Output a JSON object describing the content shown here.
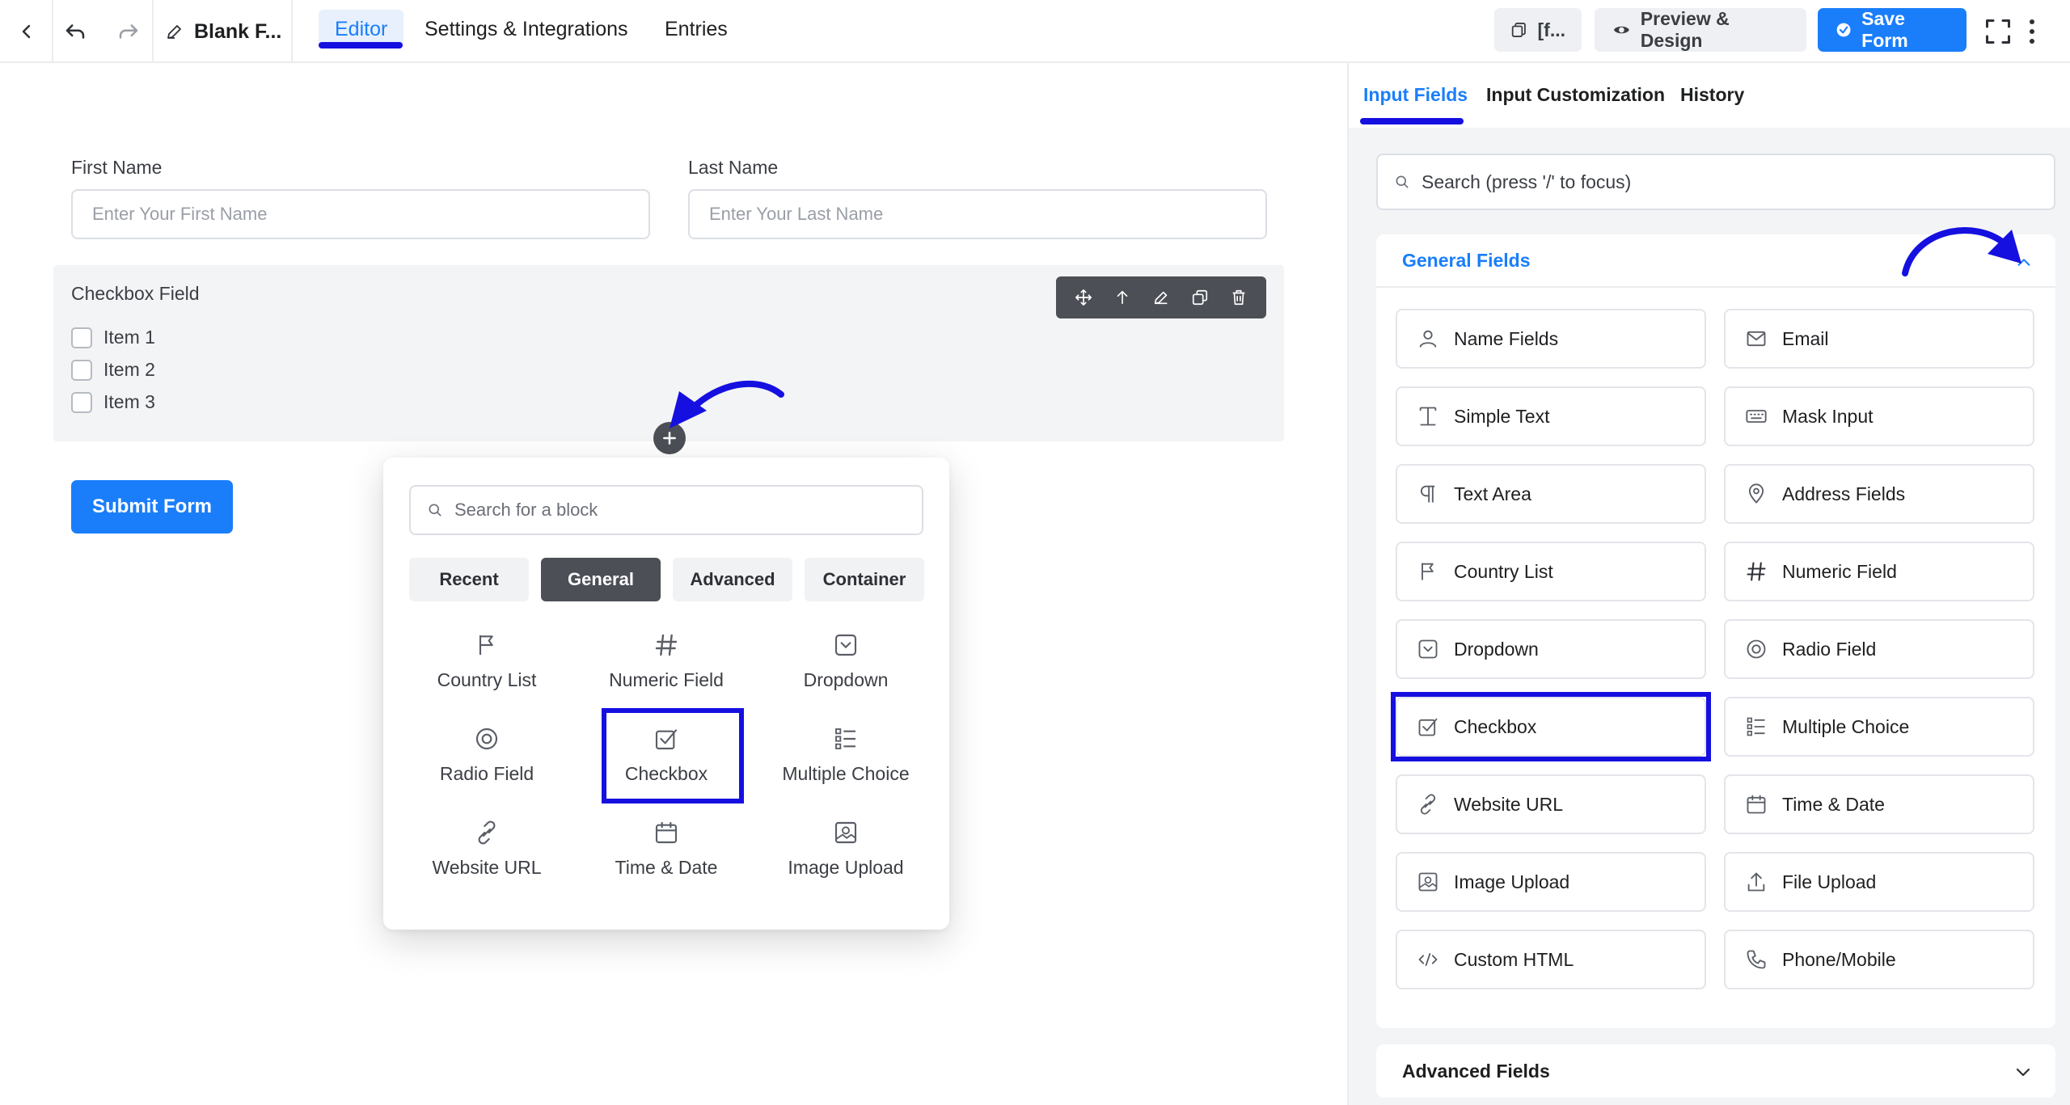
{
  "topbar": {
    "form_title": "Blank F...",
    "tabs": [
      {
        "label": "Editor",
        "active": true
      },
      {
        "label": "Settings & Integrations",
        "active": false
      },
      {
        "label": "Entries",
        "active": false
      }
    ],
    "shortcode_label": "[f...",
    "preview_label": "Preview & Design",
    "save_label": "Save Form"
  },
  "form": {
    "first_name": {
      "label": "First Name",
      "placeholder": "Enter Your First Name"
    },
    "last_name": {
      "label": "Last Name",
      "placeholder": "Enter Your Last Name"
    },
    "checkbox_field": {
      "label": "Checkbox Field",
      "items": [
        "Item 1",
        "Item 2",
        "Item 3"
      ]
    },
    "submit_label": "Submit Form"
  },
  "inserter": {
    "search_placeholder": "Search for a block",
    "tabs": [
      {
        "label": "Recent",
        "active": false
      },
      {
        "label": "General",
        "active": true
      },
      {
        "label": "Advanced",
        "active": false
      },
      {
        "label": "Container",
        "active": false
      }
    ],
    "blocks": [
      "Country List",
      "Numeric Field",
      "Dropdown",
      "Radio Field",
      "Checkbox",
      "Multiple Choice",
      "Website URL",
      "Time & Date",
      "Image Upload"
    ],
    "highlighted": "Checkbox"
  },
  "sidebar": {
    "tabs": [
      {
        "label": "Input Fields",
        "active": true
      },
      {
        "label": "Input Customization",
        "active": false
      },
      {
        "label": "History",
        "active": false
      }
    ],
    "search_placeholder": "Search (press '/' to focus)",
    "general_title": "General Fields",
    "fields": [
      {
        "label": "Name Fields",
        "icon": "user-icon"
      },
      {
        "label": "Email",
        "icon": "envelope-icon"
      },
      {
        "label": "Simple Text",
        "icon": "text-cursor-icon"
      },
      {
        "label": "Mask Input",
        "icon": "keyboard-icon"
      },
      {
        "label": "Text Area",
        "icon": "paragraph-icon"
      },
      {
        "label": "Address Fields",
        "icon": "map-pin-icon"
      },
      {
        "label": "Country List",
        "icon": "flag-icon"
      },
      {
        "label": "Numeric Field",
        "icon": "hash-icon"
      },
      {
        "label": "Dropdown",
        "icon": "dropdown-icon"
      },
      {
        "label": "Radio Field",
        "icon": "radio-icon"
      },
      {
        "label": "Checkbox",
        "icon": "checkbox-icon"
      },
      {
        "label": "Multiple Choice",
        "icon": "list-icon"
      },
      {
        "label": "Website URL",
        "icon": "link-icon"
      },
      {
        "label": "Time & Date",
        "icon": "calendar-icon"
      },
      {
        "label": "Image Upload",
        "icon": "image-icon"
      },
      {
        "label": "File Upload",
        "icon": "upload-icon"
      },
      {
        "label": "Custom HTML",
        "icon": "code-icon"
      },
      {
        "label": "Phone/Mobile",
        "icon": "phone-icon"
      }
    ],
    "highlighted_field": "Checkbox",
    "advanced_title": "Advanced Fields"
  },
  "colors": {
    "accent": "#1a7efb",
    "annotation": "#1510e0",
    "toolbar_dark": "#4c4f55"
  }
}
